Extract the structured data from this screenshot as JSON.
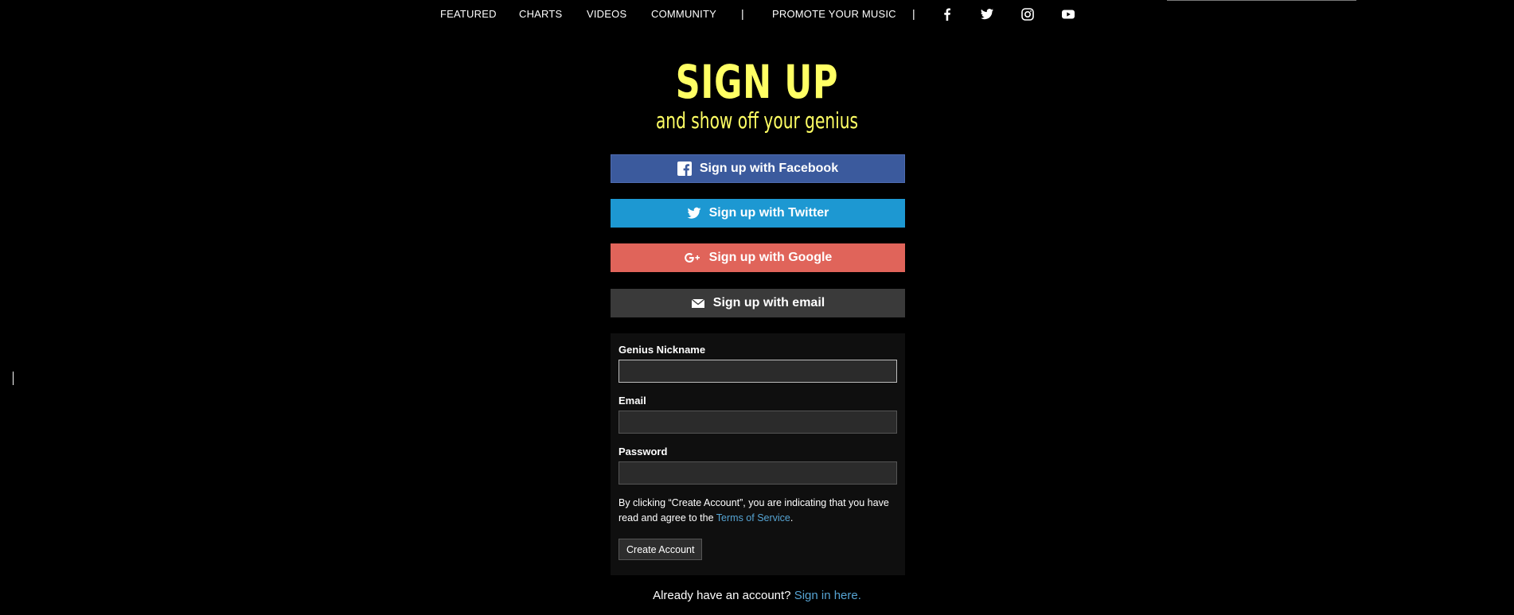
{
  "nav": {
    "links": [
      "FEATURED",
      "CHARTS",
      "VIDEOS",
      "COMMUNITY",
      "PROMOTE YOUR MUSIC"
    ],
    "separator": "|",
    "social_icons": [
      "facebook-icon",
      "twitter-icon",
      "instagram-icon",
      "youtube-icon"
    ]
  },
  "heading": {
    "title": "SIGN UP",
    "subtitle": "and show off your genius"
  },
  "social_buttons": {
    "facebook": "Sign up with Facebook",
    "twitter": "Sign up with Twitter",
    "google": "Sign up with Google",
    "email": "Sign up with email"
  },
  "form": {
    "nickname_label": "Genius Nickname",
    "nickname_value": "",
    "email_label": "Email",
    "email_value": "",
    "password_label": "Password",
    "password_value": "",
    "legal_prefix": "By clicking “Create Account”, you are indicating that you have read and agree to the ",
    "terms_link": "Terms of Service",
    "legal_suffix": ".",
    "submit_label": "Create Account"
  },
  "signin": {
    "prompt": "Already have an account?",
    "link": "Sign in here."
  },
  "colors": {
    "accent_yellow": "#ffff64",
    "facebook": "#3b5a9d",
    "twitter": "#1d98d2",
    "google": "#e0645a",
    "email": "#3a3a3a",
    "link": "#56a4d3"
  }
}
